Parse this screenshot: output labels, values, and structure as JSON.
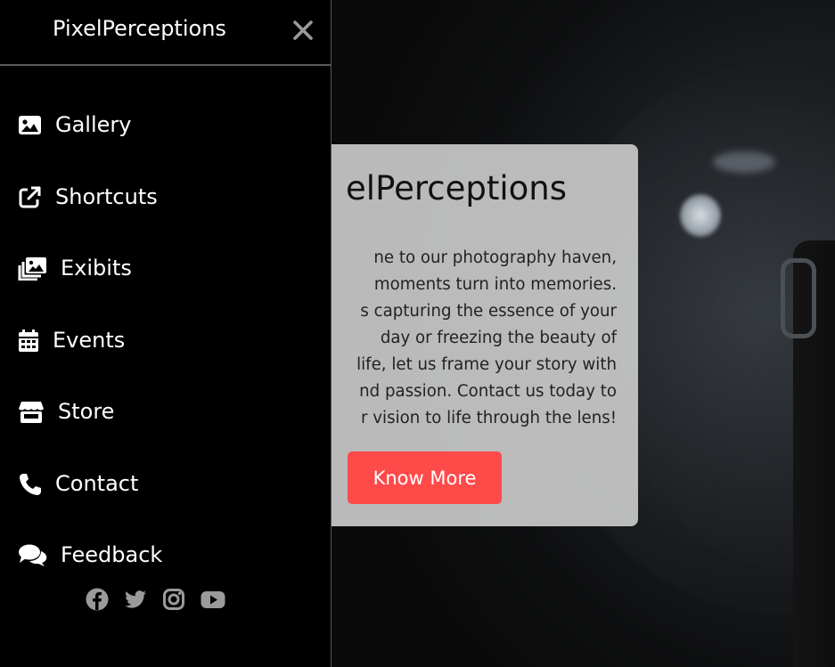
{
  "sidebar": {
    "brand": "PixelPerceptions",
    "items": [
      {
        "label": "Gallery",
        "icon": "image-icon"
      },
      {
        "label": "Shortcuts",
        "icon": "external-link-icon"
      },
      {
        "label": "Exibits",
        "icon": "photo-stack-icon"
      },
      {
        "label": "Events",
        "icon": "calendar-icon"
      },
      {
        "label": "Store",
        "icon": "store-icon"
      },
      {
        "label": "Contact",
        "icon": "phone-icon"
      },
      {
        "label": "Feedback",
        "icon": "chat-bubbles-icon"
      }
    ],
    "social": [
      "facebook-icon",
      "twitter-icon",
      "instagram-icon",
      "youtube-icon"
    ]
  },
  "hero": {
    "title": "elPerceptions",
    "lines": [
      "ne to our photography haven,",
      "moments turn into memories.",
      "s capturing the essence of your",
      "day or freezing the beauty of",
      "life, let us frame your story with",
      "nd passion. Contact us today to",
      "r vision to life through the lens!"
    ],
    "button_label": "Know More"
  },
  "colors": {
    "accent": "#ff4a4a",
    "sidebar_bg": "#000000",
    "card_bg": "#c8c8c8",
    "social_icon": "#9a9a9a"
  }
}
